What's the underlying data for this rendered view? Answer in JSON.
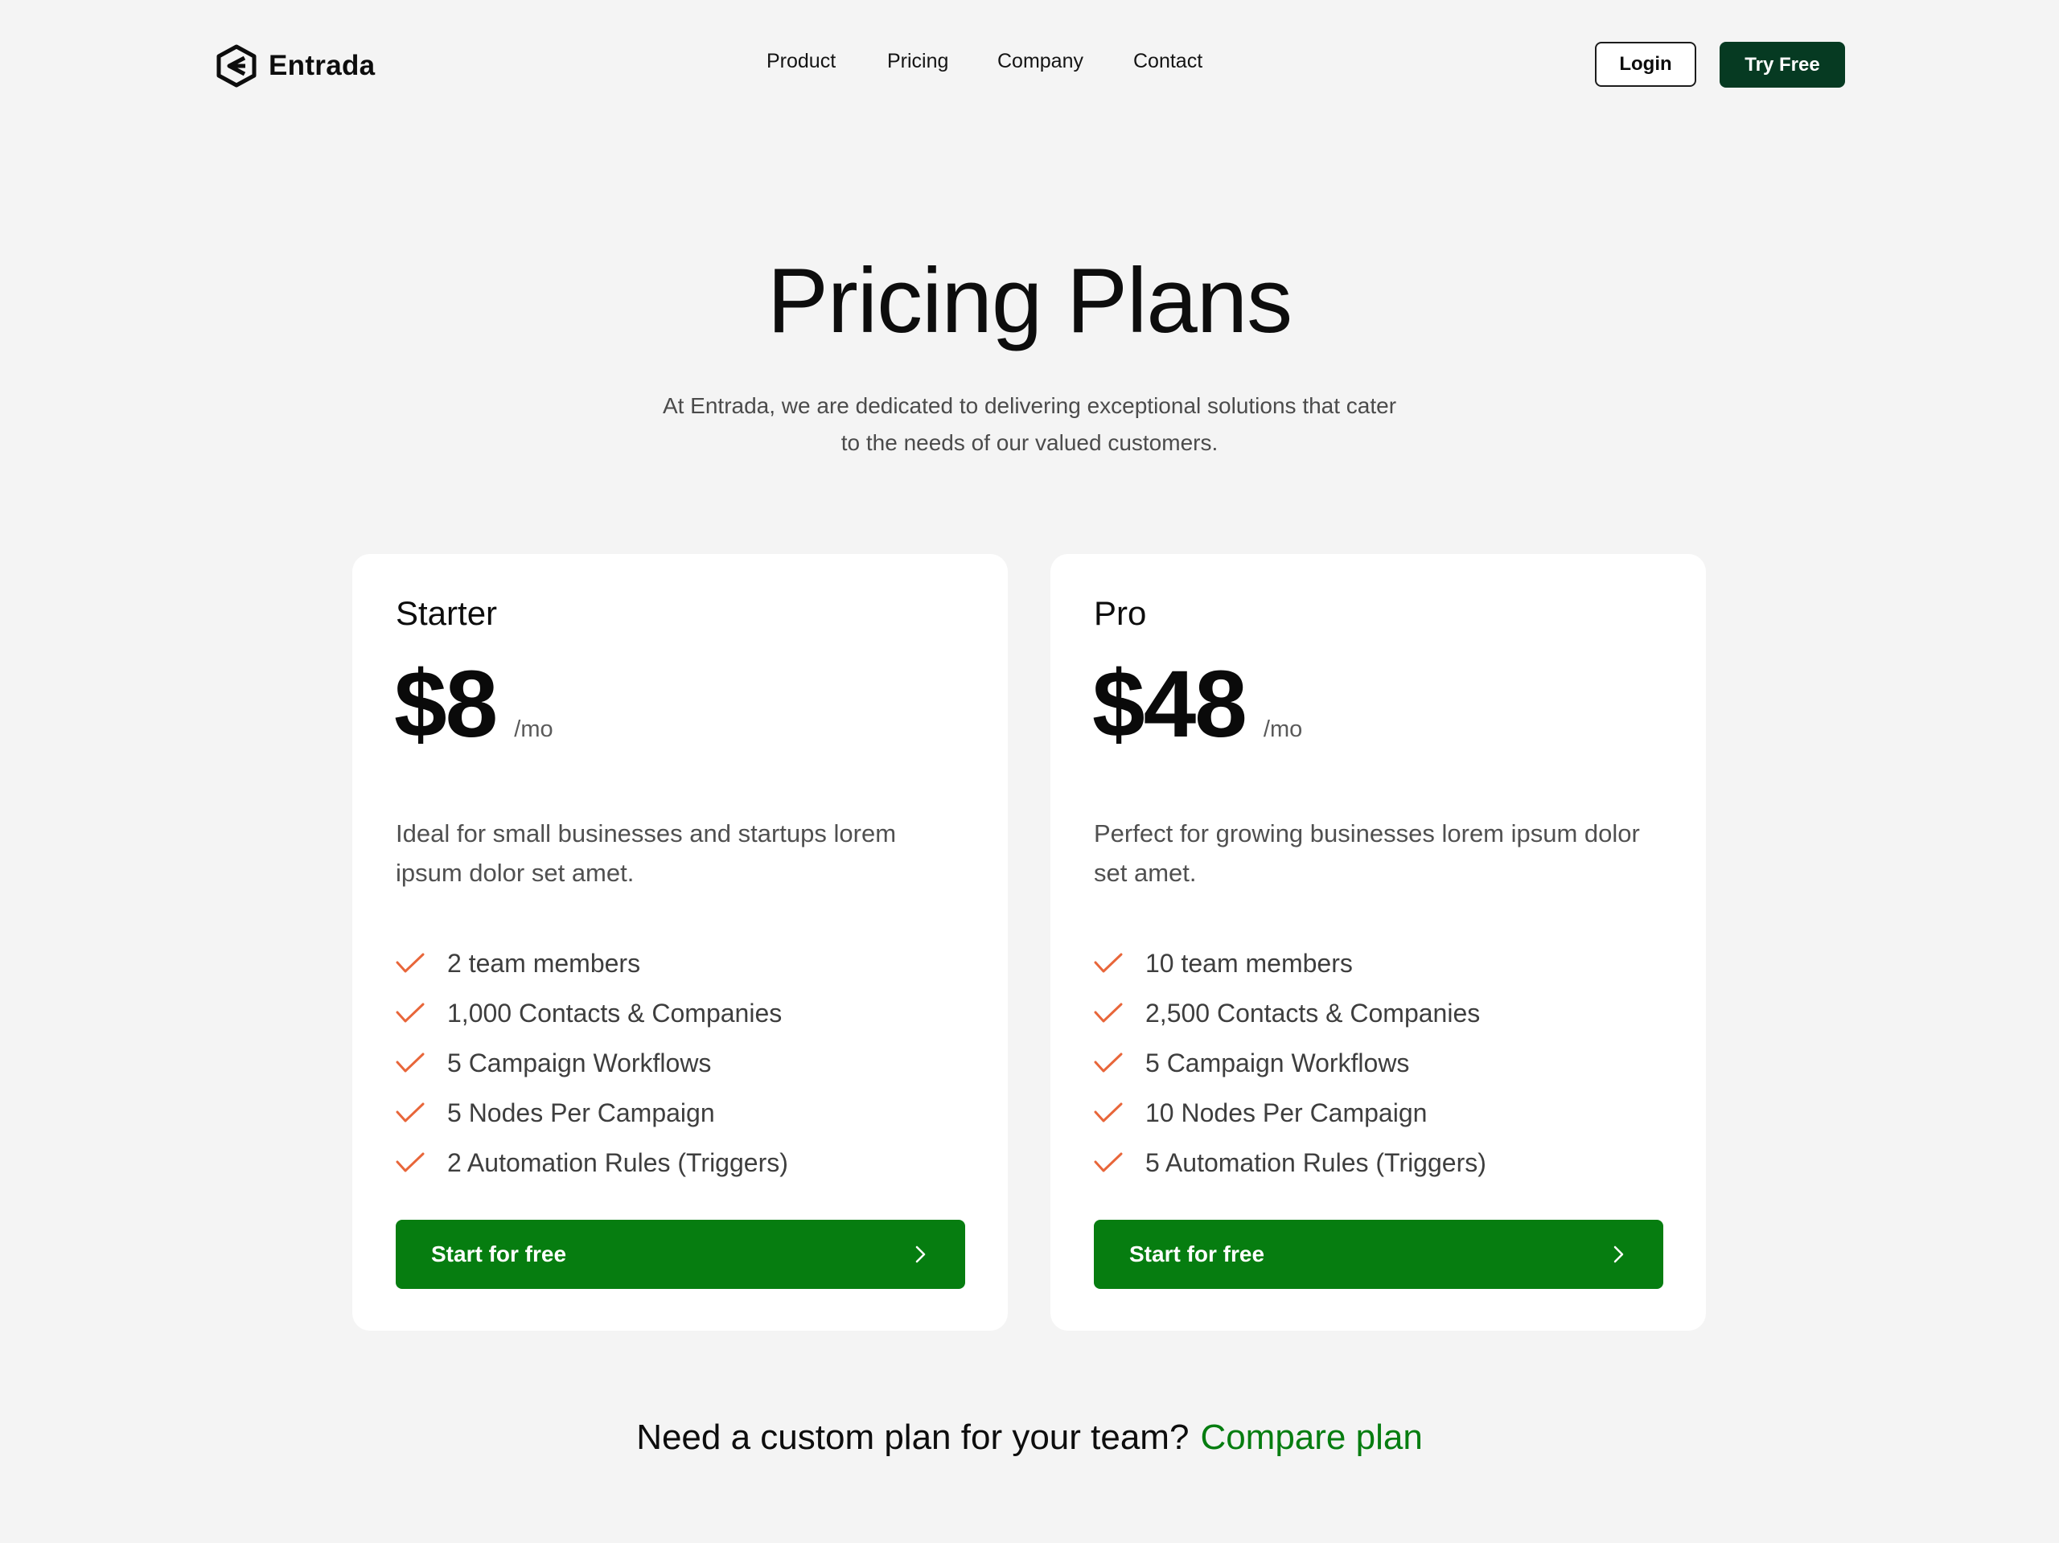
{
  "brand": {
    "name": "Entrada",
    "color": "#0d0d0d"
  },
  "nav": {
    "items": [
      {
        "label": "Product"
      },
      {
        "label": "Pricing"
      },
      {
        "label": "Company"
      },
      {
        "label": "Contact"
      }
    ]
  },
  "header_actions": {
    "login_label": "Login",
    "try_free_label": "Try Free"
  },
  "hero": {
    "title": "Pricing Plans",
    "subtitle_line1": "At Entrada, we are dedicated to delivering exceptional solutions that cater",
    "subtitle_line2": "to the needs of our valued customers."
  },
  "plans": [
    {
      "name": "Starter",
      "price": "$8",
      "period": "/mo",
      "description": "Ideal for small businesses and startups lorem ipsum dolor set amet.",
      "features": [
        "2 team members",
        "1,000 Contacts & Companies",
        "5 Campaign Workflows",
        "5 Nodes Per Campaign",
        "2 Automation Rules (Triggers)"
      ],
      "cta_label": "Start for free"
    },
    {
      "name": "Pro",
      "price": "$48",
      "period": "/mo",
      "description": "Perfect for growing businesses lorem ipsum dolor set amet.",
      "features": [
        "10 team members",
        "2,500 Contacts & Companies",
        "5 Campaign Workflows",
        "10 Nodes Per Campaign",
        "5 Automation Rules (Triggers)"
      ],
      "cta_label": "Start for free"
    }
  ],
  "footer": {
    "question": "Need a custom plan for your team?",
    "link_label": "Compare plan"
  },
  "colors": {
    "background": "#f4f4f4",
    "card": "#ffffff",
    "primary_green": "#067d10",
    "dark_green": "#063a22",
    "check_orange": "#e8663a"
  },
  "icons": {
    "logo": "hexagon-e-logo-icon",
    "feature": "check-icon",
    "cta": "chevron-right-icon"
  }
}
